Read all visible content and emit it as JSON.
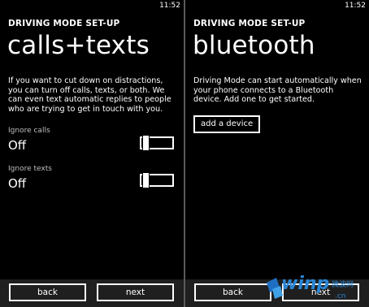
{
  "left": {
    "status_time": "11:52",
    "app_title": "DRIVING MODE SET-UP",
    "page_title": "calls+texts",
    "description": "If you want to cut down on distractions, you can turn off calls, texts, or both. We can even text automatic replies to people who are trying to get in touch with you.",
    "settings": [
      {
        "label": "Ignore calls",
        "value": "Off"
      },
      {
        "label": "Ignore texts",
        "value": "Off"
      }
    ],
    "back_label": "back",
    "next_label": "next"
  },
  "right": {
    "status_time": "11:52",
    "app_title": "DRIVING MODE SET-UP",
    "page_title": "bluetooth",
    "description": "Driving Mode can start automatically when your phone connects to a Bluetooth device. Add one to get started.",
    "add_device_label": "add a device",
    "back_label": "back",
    "next_label": "next"
  },
  "watermark": {
    "text": "winp",
    "cn_top": "微波网",
    "cn_bottom": ".cn"
  }
}
